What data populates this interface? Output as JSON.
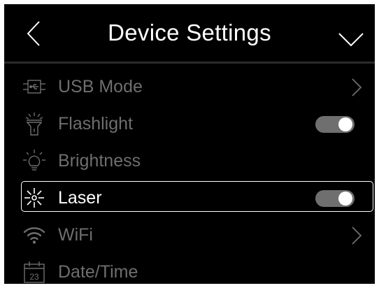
{
  "header": {
    "title": "Device Settings",
    "back_icon": "chevron-left-icon",
    "collapse_icon": "chevron-down-icon"
  },
  "settings": {
    "items": [
      {
        "label": "USB Mode",
        "icon": "usb-icon",
        "control": "chevron-right"
      },
      {
        "label": "Flashlight",
        "icon": "flashlight-icon",
        "control": "toggle",
        "toggle_on": true
      },
      {
        "label": "Brightness",
        "icon": "brightness-icon",
        "control": "none"
      },
      {
        "label": "Laser",
        "icon": "laser-icon",
        "control": "toggle",
        "toggle_on": true,
        "selected": true
      },
      {
        "label": "WiFi",
        "icon": "wifi-icon",
        "control": "chevron-right"
      },
      {
        "label": "Date/Time",
        "icon": "calendar-icon",
        "control": "none",
        "icon_text": "23"
      }
    ]
  },
  "colors": {
    "background": "#000000",
    "text_dim": "#6e6e6e",
    "text_selected": "#ffffff",
    "toggle_track": "#6f6f6f",
    "toggle_knob": "#ffffff"
  }
}
